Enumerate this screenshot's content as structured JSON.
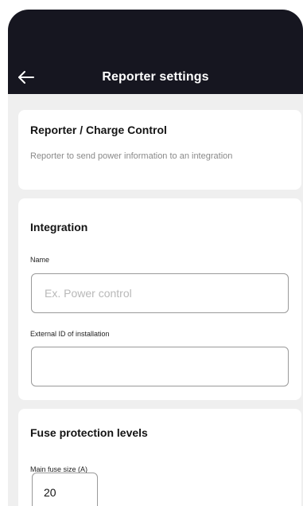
{
  "header": {
    "back_icon": "arrow-left-icon",
    "title": "Reporter settings"
  },
  "reporter_card": {
    "title": "Reporter / Charge Control",
    "description": "Reporter to send power information to an integration"
  },
  "integration_card": {
    "title": "Integration",
    "name_label": "Name",
    "name_placeholder": "Ex. Power control",
    "name_value": "",
    "external_id_label": "External ID of installation",
    "external_id_value": ""
  },
  "fuse_card": {
    "title": "Fuse protection levels",
    "main_fuse_label": "Main fuse size (A)",
    "main_fuse_value": "20"
  },
  "colors": {
    "header_background": "#161620",
    "page_background": "#efefef",
    "card_background": "#ffffff",
    "input_border": "#9a9a9a",
    "muted_text": "#8a8a8a"
  }
}
